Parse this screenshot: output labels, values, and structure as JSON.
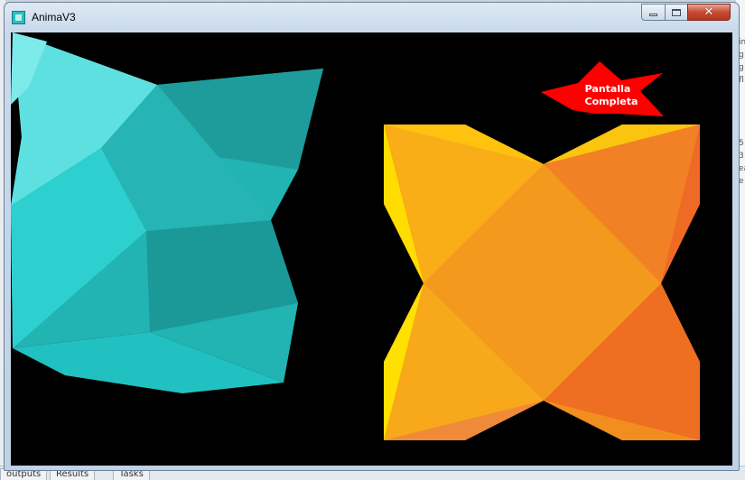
{
  "window": {
    "title": "AnimaV3",
    "controls": {
      "minimize": "minimize",
      "maximize": "maximize",
      "close": "close"
    }
  },
  "canvas": {
    "background": "#000000",
    "star_button": {
      "line1": "Pantalla",
      "line2": "Completa",
      "color": "#ff0000"
    },
    "colors": {
      "cyan": "#28c6c6",
      "orange": "#f39a1e",
      "yellow": "#ffd200",
      "red_orange": "#ee5a22"
    }
  },
  "background_app": {
    "side_text": [
      "img",
      "g",
      "g",
      "fl",
      "5",
      "3",
      "ea",
      "e"
    ],
    "bottom_tabs": [
      "outputs",
      "Results",
      "Tasks"
    ]
  }
}
